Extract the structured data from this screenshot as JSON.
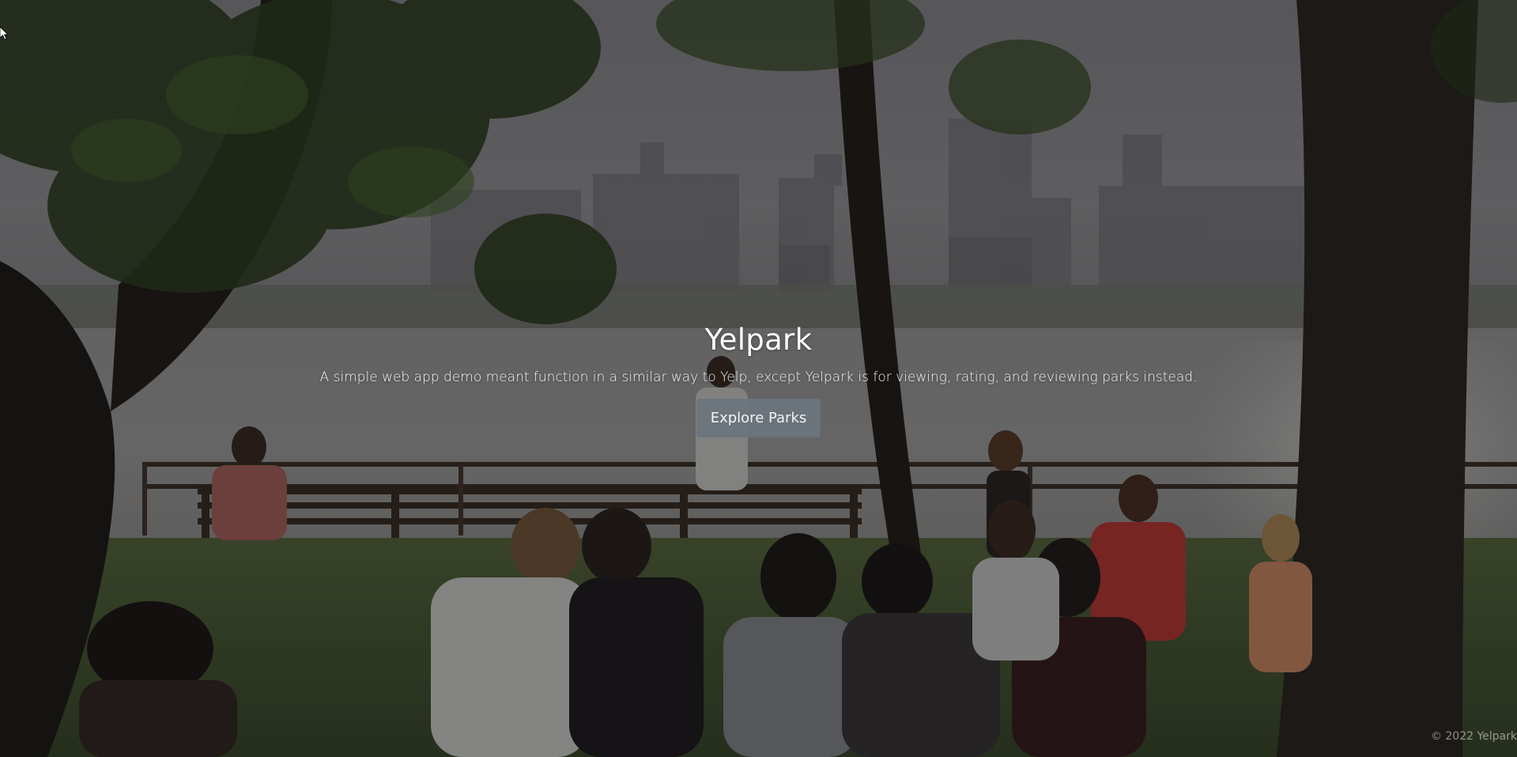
{
  "hero": {
    "title": "Yelpark",
    "subtitle": "A simple web app demo meant function in a similar way to Yelp, except Yelpark is for viewing, rating, and reviewing parks instead.",
    "cta_label": "Explore Parks",
    "background_description_icon": "park-photo-icon"
  },
  "footer": {
    "copyright": "© 2022 Yelpark"
  },
  "colors": {
    "button_bg": "#6c757d",
    "text": "#ffffff",
    "overlay": "#0a0a0c"
  }
}
